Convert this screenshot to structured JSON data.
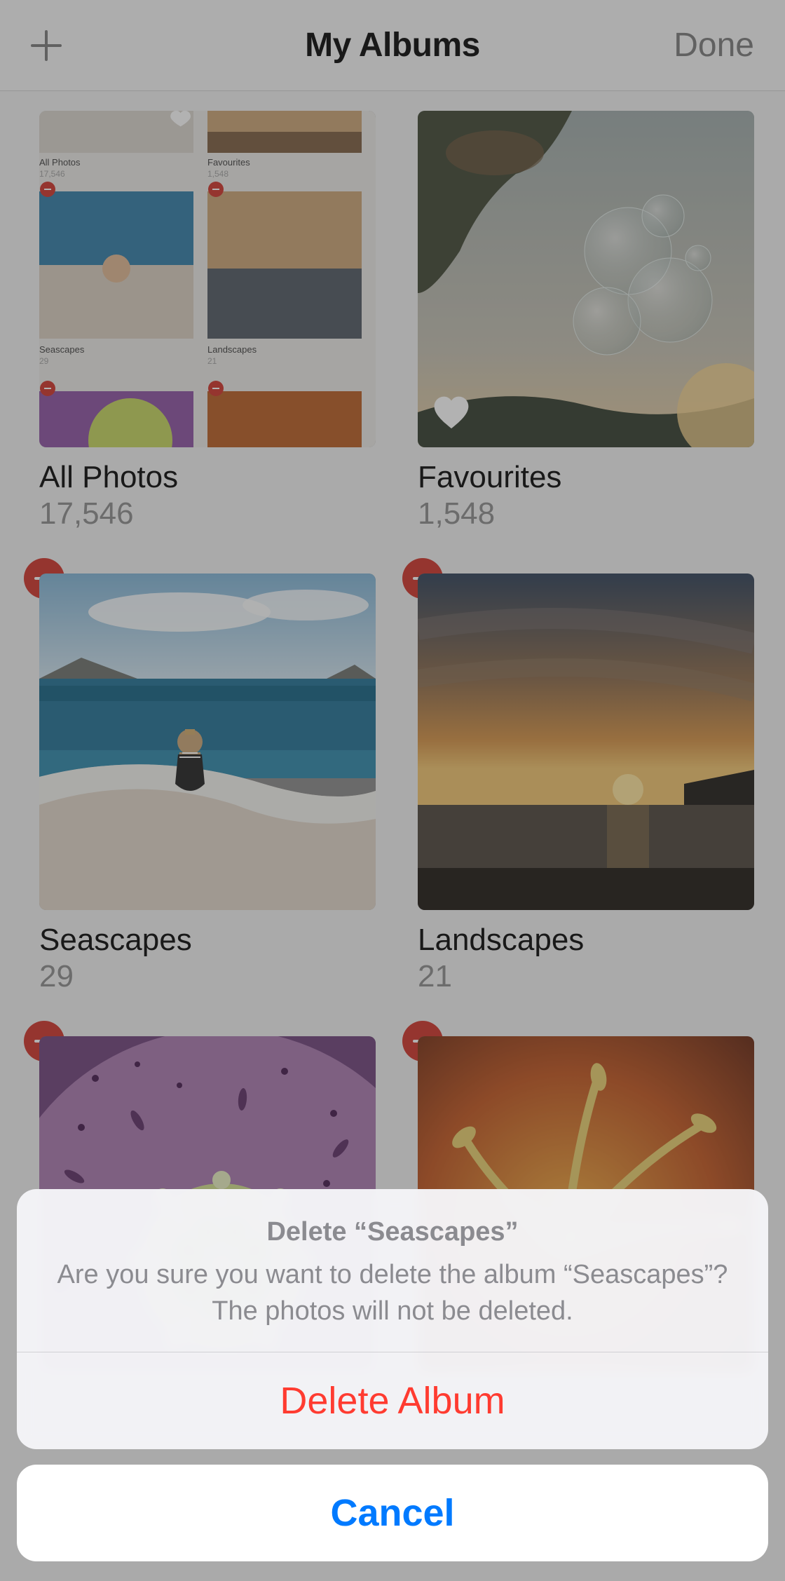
{
  "header": {
    "title": "My Albums",
    "done_label": "Done"
  },
  "albums": [
    {
      "title": "All Photos",
      "count": "17,546",
      "deletable": false,
      "kind": "collage",
      "heart": false
    },
    {
      "title": "Favourites",
      "count": "1,548",
      "deletable": false,
      "kind": "bubbles",
      "heart": true
    },
    {
      "title": "Seascapes",
      "count": "29",
      "deletable": true,
      "kind": "beach",
      "heart": false
    },
    {
      "title": "Landscapes",
      "count": "21",
      "deletable": true,
      "kind": "sunset",
      "heart": false
    },
    {
      "title": "",
      "count": "",
      "deletable": true,
      "kind": "flower",
      "heart": false,
      "partial": true
    },
    {
      "title": "",
      "count": "",
      "deletable": true,
      "kind": "orange",
      "heart": false,
      "partial": true
    }
  ],
  "sheet": {
    "title": "Delete “Seascapes”",
    "message": "Are you sure you want to delete the album “Seascapes”? The photos will not be deleted.",
    "delete_label": "Delete Album",
    "cancel_label": "Cancel"
  }
}
